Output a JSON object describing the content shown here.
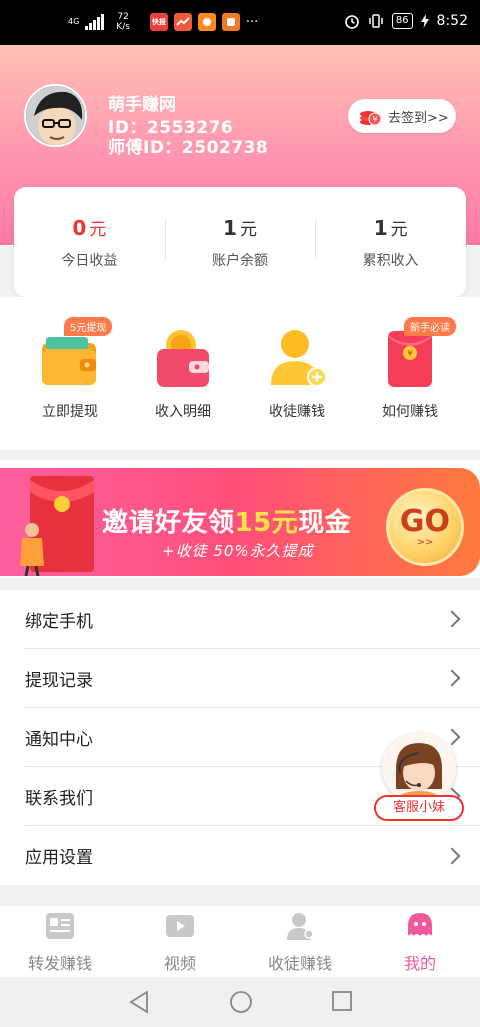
{
  "status_bar": {
    "network": "4G",
    "speed": "72",
    "speed_unit": "K/s",
    "app_icons": [
      {
        "name": "app-icon-1",
        "text": "快报",
        "color": "#e8423a"
      },
      {
        "name": "app-icon-2",
        "text": "",
        "color": "#f05a3a"
      },
      {
        "name": "app-icon-3",
        "text": "",
        "color": "#ff8a1e"
      },
      {
        "name": "app-icon-4",
        "text": "",
        "color": "#f07b22"
      }
    ],
    "more": "···",
    "battery": "86",
    "time": "8:52"
  },
  "profile": {
    "app_name": "萌手赚网",
    "user_id": "ID：2553276",
    "master_id": "师傅ID：2502738",
    "checkin_label": "去签到>>"
  },
  "stats": [
    {
      "value": "0",
      "unit": "元",
      "label": "今日收益",
      "highlight": true
    },
    {
      "value": "1",
      "unit": "元",
      "label": "账户余额",
      "highlight": false
    },
    {
      "value": "1",
      "unit": "元",
      "label": "累积收入",
      "highlight": false
    }
  ],
  "actions": [
    {
      "label": "立即提现",
      "badge": "5元提现",
      "icon": "wallet-icon"
    },
    {
      "label": "收入明细",
      "badge": "",
      "icon": "coin-wallet-icon"
    },
    {
      "label": "收徒赚钱",
      "badge": "",
      "icon": "add-user-icon"
    },
    {
      "label": "如何赚钱",
      "badge": "新手必读",
      "icon": "red-envelope-icon"
    }
  ],
  "banner": {
    "title_prefix": "邀请好友领",
    "title_highlight": "15元",
    "title_suffix": "现金",
    "subtitle": "+收徒 50%永久提成",
    "go_label": "GO",
    "go_arrow": ">>"
  },
  "menu": [
    {
      "label": "绑定手机"
    },
    {
      "label": "提现记录"
    },
    {
      "label": "通知中心"
    },
    {
      "label": "联系我们"
    },
    {
      "label": "应用设置"
    }
  ],
  "customer_service": {
    "label": "客服小妹"
  },
  "tabs": [
    {
      "label": "转发赚钱",
      "icon": "share-icon",
      "active": false
    },
    {
      "label": "视频",
      "icon": "video-icon",
      "active": false
    },
    {
      "label": "收徒赚钱",
      "icon": "user-icon",
      "active": false
    },
    {
      "label": "我的",
      "icon": "mine-icon",
      "active": true
    }
  ],
  "colors": {
    "accent": "#f05a9b",
    "header_top": "#ffc1b4",
    "header_bottom": "#ff7aa2",
    "highlight_red": "#ee3333"
  }
}
